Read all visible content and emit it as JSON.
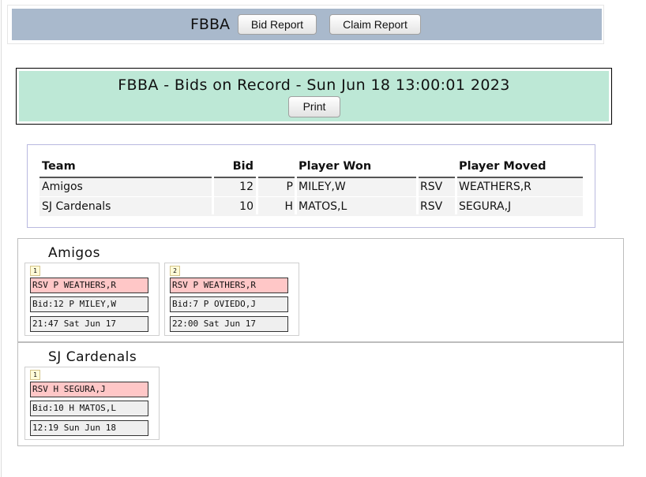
{
  "nav": {
    "title": "FBBA",
    "bid_report": "Bid Report",
    "claim_report": "Claim Report"
  },
  "header": {
    "title": "FBBA - Bids on Record - Sun Jun 18 13:00:01 2023",
    "print": "Print"
  },
  "summary": {
    "headers": {
      "team": "Team",
      "bid": "Bid",
      "player_won": "Player Won",
      "player_moved": "Player Moved"
    },
    "rows": [
      {
        "team": "Amigos",
        "bid": "12",
        "pos": "P",
        "player_won": "MILEY,W",
        "status": "RSV",
        "player_moved": "WEATHERS,R"
      },
      {
        "team": "SJ Cardenals",
        "bid": "10",
        "pos": "H",
        "player_won": "MATOS,L",
        "status": "RSV",
        "player_moved": "SEGURA,J"
      }
    ]
  },
  "teams": [
    {
      "name": "Amigos",
      "cards": [
        {
          "num": "1",
          "move": "RSV P WEATHERS,R",
          "bid": "Bid:12 P MILEY,W",
          "time": "21:47 Sat Jun 17"
        },
        {
          "num": "2",
          "move": "RSV P WEATHERS,R",
          "bid": "Bid:7 P OVIEDO,J",
          "time": "22:00 Sat Jun 17"
        }
      ]
    },
    {
      "name": "SJ Cardenals",
      "cards": [
        {
          "num": "1",
          "move": "RSV H SEGURA,J",
          "bid": "Bid:10 H MATOS,L",
          "time": "12:19 Sun Jun 18"
        }
      ]
    }
  ],
  "colors": {
    "nav_bg": "#a9b9cc",
    "header_bg": "#bde8d6",
    "move_line_bg": "#ffc7c7",
    "badge_bg": "#fffbd8"
  }
}
